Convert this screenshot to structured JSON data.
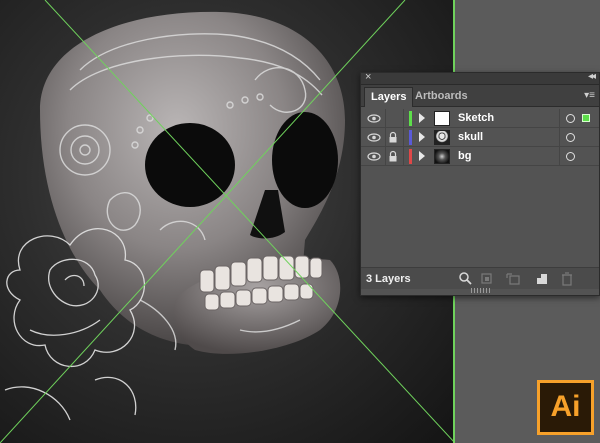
{
  "colors": {
    "artboard_guide": "#6fd25c",
    "sketch_layer": "#5dde4a",
    "skull_layer": "#5a5ad8",
    "bg_layer": "#e04848",
    "ai_orange": "#f7a12a",
    "ai_dark": "#2a1a06"
  },
  "panel": {
    "close_glyph": "×",
    "collapse_glyph": "◂◂",
    "menu_glyph": "▾≡",
    "tabs": [
      {
        "label": "Layers",
        "active": true
      },
      {
        "label": "Artboards",
        "active": false
      }
    ],
    "layers": [
      {
        "name": "Sketch",
        "color": "#5dde4a",
        "thumb": "white",
        "visible": true,
        "locked": false,
        "selected": true
      },
      {
        "name": "skull",
        "color": "#5a5ad8",
        "thumb": "skull",
        "visible": true,
        "locked": true,
        "selected": false
      },
      {
        "name": "bg",
        "color": "#e04848",
        "thumb": "bg",
        "visible": true,
        "locked": true,
        "selected": false
      }
    ],
    "footer": {
      "count_label": "3 Layers",
      "icons": [
        "locate-object-icon",
        "make-clipping-mask-icon",
        "create-sublayer-icon",
        "new-layer-icon",
        "delete-icon"
      ]
    }
  },
  "badge": {
    "text": "Ai"
  }
}
